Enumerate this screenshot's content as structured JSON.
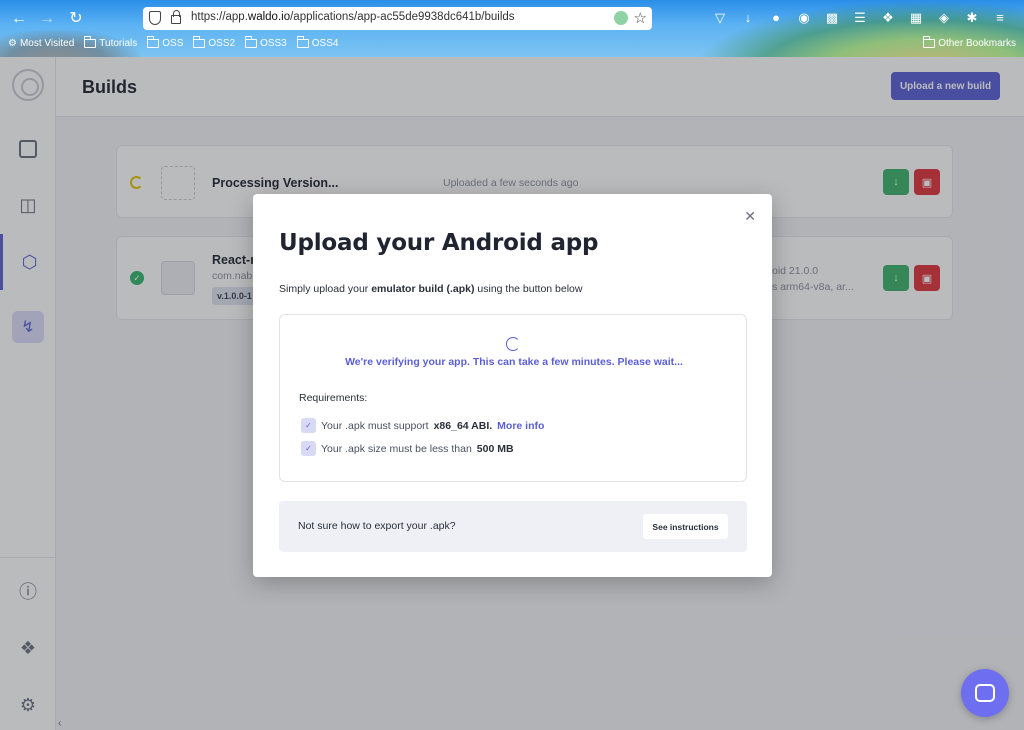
{
  "browser": {
    "url_prefix": "https://app.",
    "url_domain": "waldo.io",
    "url_path": "/applications/app-ac55de9938dc641b/builds",
    "bookmarks": [
      "Most Visited",
      "Tutorials",
      "OSS",
      "OSS2",
      "OSS3",
      "OSS4"
    ],
    "other_bookmarks": "Other Bookmarks"
  },
  "page": {
    "title": "Builds",
    "upload_button": "Upload a new build"
  },
  "builds": [
    {
      "name": "Processing Version...",
      "uploaded": "Uploaded a few seconds ago",
      "status": "processing"
    },
    {
      "name": "React-n",
      "package": "com.nab",
      "version": "v.1.0.0-1",
      "meta_line1": "oid 21.0.0",
      "meta_line2": "s arm64-v8a, ar...",
      "status": "ready"
    }
  ],
  "modal": {
    "title": "Upload your Android app",
    "intro_prefix": "Simply upload your ",
    "intro_bold": "emulator build (.apk)",
    "intro_suffix": " using the button below",
    "status": "We're verifying your app. This can take a few minutes. Please wait...",
    "requirements_title": "Requirements:",
    "req1_prefix": "Your .apk must support ",
    "req1_bold": "x86_64 ABI.",
    "req1_link": "More info",
    "req2_prefix": "Your .apk size must be less than ",
    "req2_bold": "500 MB",
    "export_question": "Not sure how to export your .apk?",
    "export_button": "See instructions"
  },
  "colors": {
    "accent": "#5b5fd6",
    "success": "#3db36a",
    "danger": "#e0343b",
    "processing": "#e6c200"
  }
}
